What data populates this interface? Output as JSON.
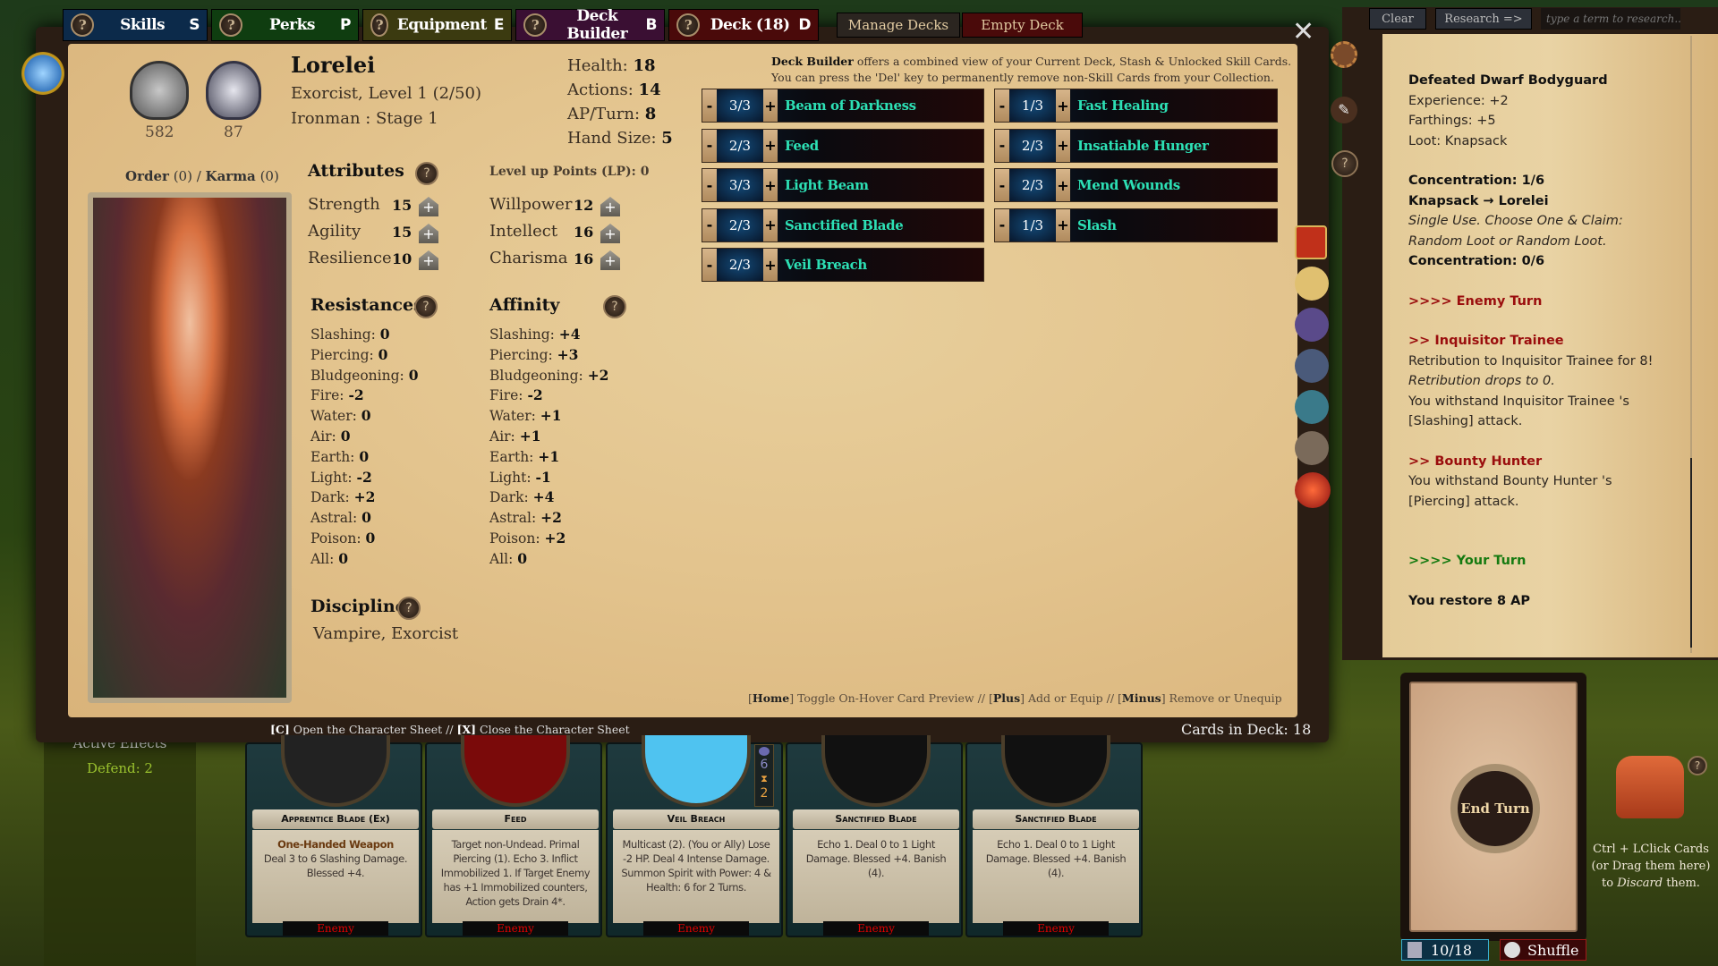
{
  "tabs": [
    {
      "label": "Skills",
      "key": "S",
      "color": "#0c2a4a"
    },
    {
      "label": "Perks",
      "key": "P",
      "color": "#0f3d10"
    },
    {
      "label": "Equipment",
      "key": "E",
      "color": "#3b3a10"
    },
    {
      "label": "Deck Builder",
      "key": "B",
      "color": "#3a0f33"
    },
    {
      "label": "Deck (18)",
      "key": "D",
      "color": "#4a0a0a"
    }
  ],
  "manage_decks": "Manage Decks",
  "empty_deck": "Empty Deck",
  "character": {
    "name": "Lorelei",
    "class_line": "Exorcist, Level 1 (2/50)",
    "mode_line": "Ironman : Stage 1",
    "badge1_value": "582",
    "badge2_value": "87",
    "order_label": "Order",
    "order_value": "(0)",
    "karma_label": "Karma",
    "karma_value": "(0)",
    "health": "Health:",
    "health_v": "18",
    "actions": "Actions:",
    "actions_v": "14",
    "ap": "AP/Turn:",
    "ap_v": "8",
    "hand": "Hand Size:",
    "hand_v": "5"
  },
  "attributes": {
    "title": "Attributes",
    "lp_label": "Level up Points (LP): 0",
    "left": [
      {
        "name": "Strength",
        "value": "15"
      },
      {
        "name": "Agility",
        "value": "15"
      },
      {
        "name": "Resilience",
        "value": "10"
      }
    ],
    "right": [
      {
        "name": "Willpower",
        "value": "12"
      },
      {
        "name": "Intellect",
        "value": "16"
      },
      {
        "name": "Charisma",
        "value": "16"
      }
    ]
  },
  "resistances": {
    "title": "Resistances",
    "items": [
      [
        "Slashing:",
        "0"
      ],
      [
        "Piercing:",
        "0"
      ],
      [
        "Bludgeoning:",
        "0"
      ],
      [
        "Fire:",
        "-2"
      ],
      [
        "Water:",
        "0"
      ],
      [
        "Air:",
        "0"
      ],
      [
        "Earth:",
        "0"
      ],
      [
        "Light:",
        "-2"
      ],
      [
        "Dark:",
        "+2"
      ],
      [
        "Astral:",
        "0"
      ],
      [
        "Poison:",
        "0"
      ],
      [
        "All:",
        "0"
      ]
    ]
  },
  "affinity": {
    "title": "Affinity",
    "items": [
      [
        "Slashing:",
        "+4"
      ],
      [
        "Piercing:",
        "+3"
      ],
      [
        "Bludgeoning:",
        "+2"
      ],
      [
        "Fire:",
        "-2"
      ],
      [
        "Water:",
        "+1"
      ],
      [
        "Air:",
        "+1"
      ],
      [
        "Earth:",
        "+1"
      ],
      [
        "Light:",
        "-1"
      ],
      [
        "Dark:",
        "+4"
      ],
      [
        "Astral:",
        "+2"
      ],
      [
        "Poison:",
        "+2"
      ],
      [
        "All:",
        "0"
      ]
    ]
  },
  "disciplines": {
    "title": "Disciplines",
    "value": "Vampire, Exorcist"
  },
  "deck_builder": {
    "intro_bold": "Deck Builder",
    "intro_rest": " offers a combined view of your Current Deck, Stash & Unlocked Skill Cards.",
    "intro2": "You can press the 'Del' key to permanently remove non-Skill Cards from your Collection.",
    "left": [
      {
        "count": "3/3",
        "name": "Beam of Darkness"
      },
      {
        "count": "2/3",
        "name": "Feed"
      },
      {
        "count": "3/3",
        "name": "Light Beam"
      },
      {
        "count": "2/3",
        "name": "Sanctified Blade"
      },
      {
        "count": "2/3",
        "name": "Veil Breach"
      }
    ],
    "right": [
      {
        "count": "1/3",
        "name": "Fast Healing"
      },
      {
        "count": "2/3",
        "name": "Insatiable Hunger"
      },
      {
        "count": "2/3",
        "name": "Mend Wounds"
      },
      {
        "count": "1/3",
        "name": "Slash"
      }
    ],
    "minus": "-",
    "plus": "+",
    "hint_home": "Home",
    "hint_home_t": "] Toggle On-Hover Card Preview // [",
    "hint_plus": "Plus",
    "hint_plus_t": "] Add or Equip // [",
    "hint_minus": "Minus",
    "hint_minus_t": "] Remove or Unequip",
    "cards_in_deck": "Cards in Deck: 18"
  },
  "footer": {
    "c_key": "[C]",
    "c_text": " Open the Character Sheet // ",
    "x_key": "[X]",
    "x_text": " Close the Character Sheet"
  },
  "research": {
    "clear": "Clear",
    "research": "Research =>",
    "placeholder": "type a term to research..."
  },
  "log": [
    {
      "c": "b",
      "t": "Defeated Dwarf Bodyguard"
    },
    {
      "c": "",
      "t": "Experience: +2"
    },
    {
      "c": "",
      "t": "Farthings: +5"
    },
    {
      "c": "",
      "t": "Loot: Knapsack"
    },
    {
      "c": "",
      "t": " "
    },
    {
      "c": "b",
      "t": "Concentration: 1/6"
    },
    {
      "c": "b",
      "t": "Knapsack → Lorelei"
    },
    {
      "c": "i",
      "t": "Single Use.  Choose One & Claim: Random Loot or Random Loot."
    },
    {
      "c": "b",
      "t": "Concentration: 0/6"
    },
    {
      "c": "",
      "t": " "
    },
    {
      "c": "r",
      "t": ">>>> Enemy Turn"
    },
    {
      "c": "",
      "t": " "
    },
    {
      "c": "r",
      "t": " >> Inquisitor Trainee"
    },
    {
      "c": "",
      "t": "Retribution to Inquisitor Trainee  for 8!"
    },
    {
      "c": "i",
      "t": "Retribution drops to 0."
    },
    {
      "c": "",
      "t": "You withstand Inquisitor Trainee 's [Slashing] attack."
    },
    {
      "c": "",
      "t": " "
    },
    {
      "c": "r",
      "t": " >> Bounty Hunter"
    },
    {
      "c": "",
      "t": "You withstand Bounty Hunter 's [Piercing] attack."
    },
    {
      "c": "",
      "t": " "
    },
    {
      "c": "",
      "t": " "
    },
    {
      "c": "g",
      "t": ">>>> Your Turn"
    },
    {
      "c": "",
      "t": " "
    },
    {
      "c": "b",
      "t": "You restore 8 AP"
    }
  ],
  "active_effects": {
    "title": "Active Effects",
    "defend": "Defend: 2"
  },
  "hand": [
    {
      "title": "Apprentice Blade (Ex)",
      "sub": "One-Handed Weapon",
      "text": "Deal 3 to 6 Slashing Damage. Blessed +4.",
      "target": "Enemy",
      "art": "#222"
    },
    {
      "title": "Feed",
      "sub": "",
      "text": "Target non-Undead. Primal Piercing (1). Echo 3. Inflict Immobilized 1. If Target Enemy has +1 Immobilized counters, Action gets Drain 4*.",
      "target": "Enemy",
      "art": "#7a0a0a"
    },
    {
      "title": "Veil Breach",
      "sub": "",
      "text": "Multicast (2). (You or Ally) Lose -2 HP. Deal 4 Intense Damage. Summon Spirit with Power: 4 & Health: 6 for 2 Turns.",
      "target": "Enemy",
      "art": "#4fc3f0"
    },
    {
      "title": "Sanctified Blade",
      "sub": "",
      "text": "Echo 1. Deal 0 to 1 Light Damage. Blessed +4. Banish (4).",
      "target": "Enemy",
      "art": "#111"
    },
    {
      "title": "Sanctified Blade",
      "sub": "",
      "text": "Echo 1. Deal 0 to 1 Light Damage. Blessed +4. Banish (4).",
      "target": "Enemy",
      "art": "#111"
    }
  ],
  "veil_counters": {
    "a": "6",
    "b": "2"
  },
  "end_turn": "End Turn",
  "deck_counter": "10/18",
  "shuffle": "Shuffle",
  "discard_hint": {
    "l1": "Ctrl + LClick Cards",
    "l2": "(or Drag them here)",
    "l3a": "to ",
    "l3b": "Discard",
    "l3c": " them."
  }
}
